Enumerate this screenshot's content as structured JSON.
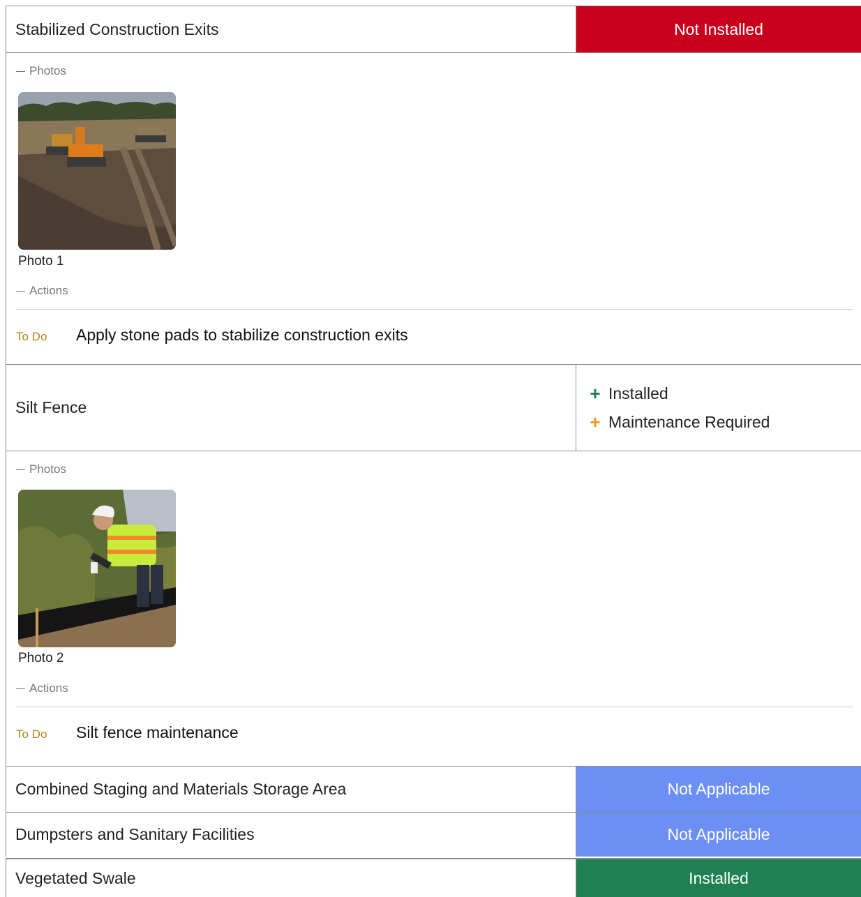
{
  "colors": {
    "not_installed": "#c8001e",
    "not_applicable": "#6b8ff5",
    "installed": "#1e8053",
    "plus_green": "#1e8053",
    "plus_orange": "#f39a1e",
    "todo": "#b5821c"
  },
  "items": [
    {
      "name": "Stabilized Construction Exits",
      "status": "Not Installed",
      "photos_label": "Photos",
      "photo_caption": "Photo 1",
      "actions_label": "Actions",
      "action_tag": "To Do",
      "action_text": "Apply stone pads to stabilize construction exits"
    },
    {
      "name": "Silt Fence",
      "statuses": [
        {
          "label": "Installed",
          "icon": "plus-icon",
          "color": "#1e8053"
        },
        {
          "label": "Maintenance Required",
          "icon": "plus-icon",
          "color": "#f39a1e"
        }
      ],
      "photos_label": "Photos",
      "photo_caption": "Photo 2",
      "actions_label": "Actions",
      "action_tag": "To Do",
      "action_text": "Silt fence maintenance"
    },
    {
      "name": "Combined Staging and Materials Storage Area",
      "status": "Not Applicable"
    },
    {
      "name": "Dumpsters and Sanitary Facilities",
      "status": "Not Applicable"
    },
    {
      "name": "Vegetated Swale",
      "status": "Installed"
    }
  ]
}
